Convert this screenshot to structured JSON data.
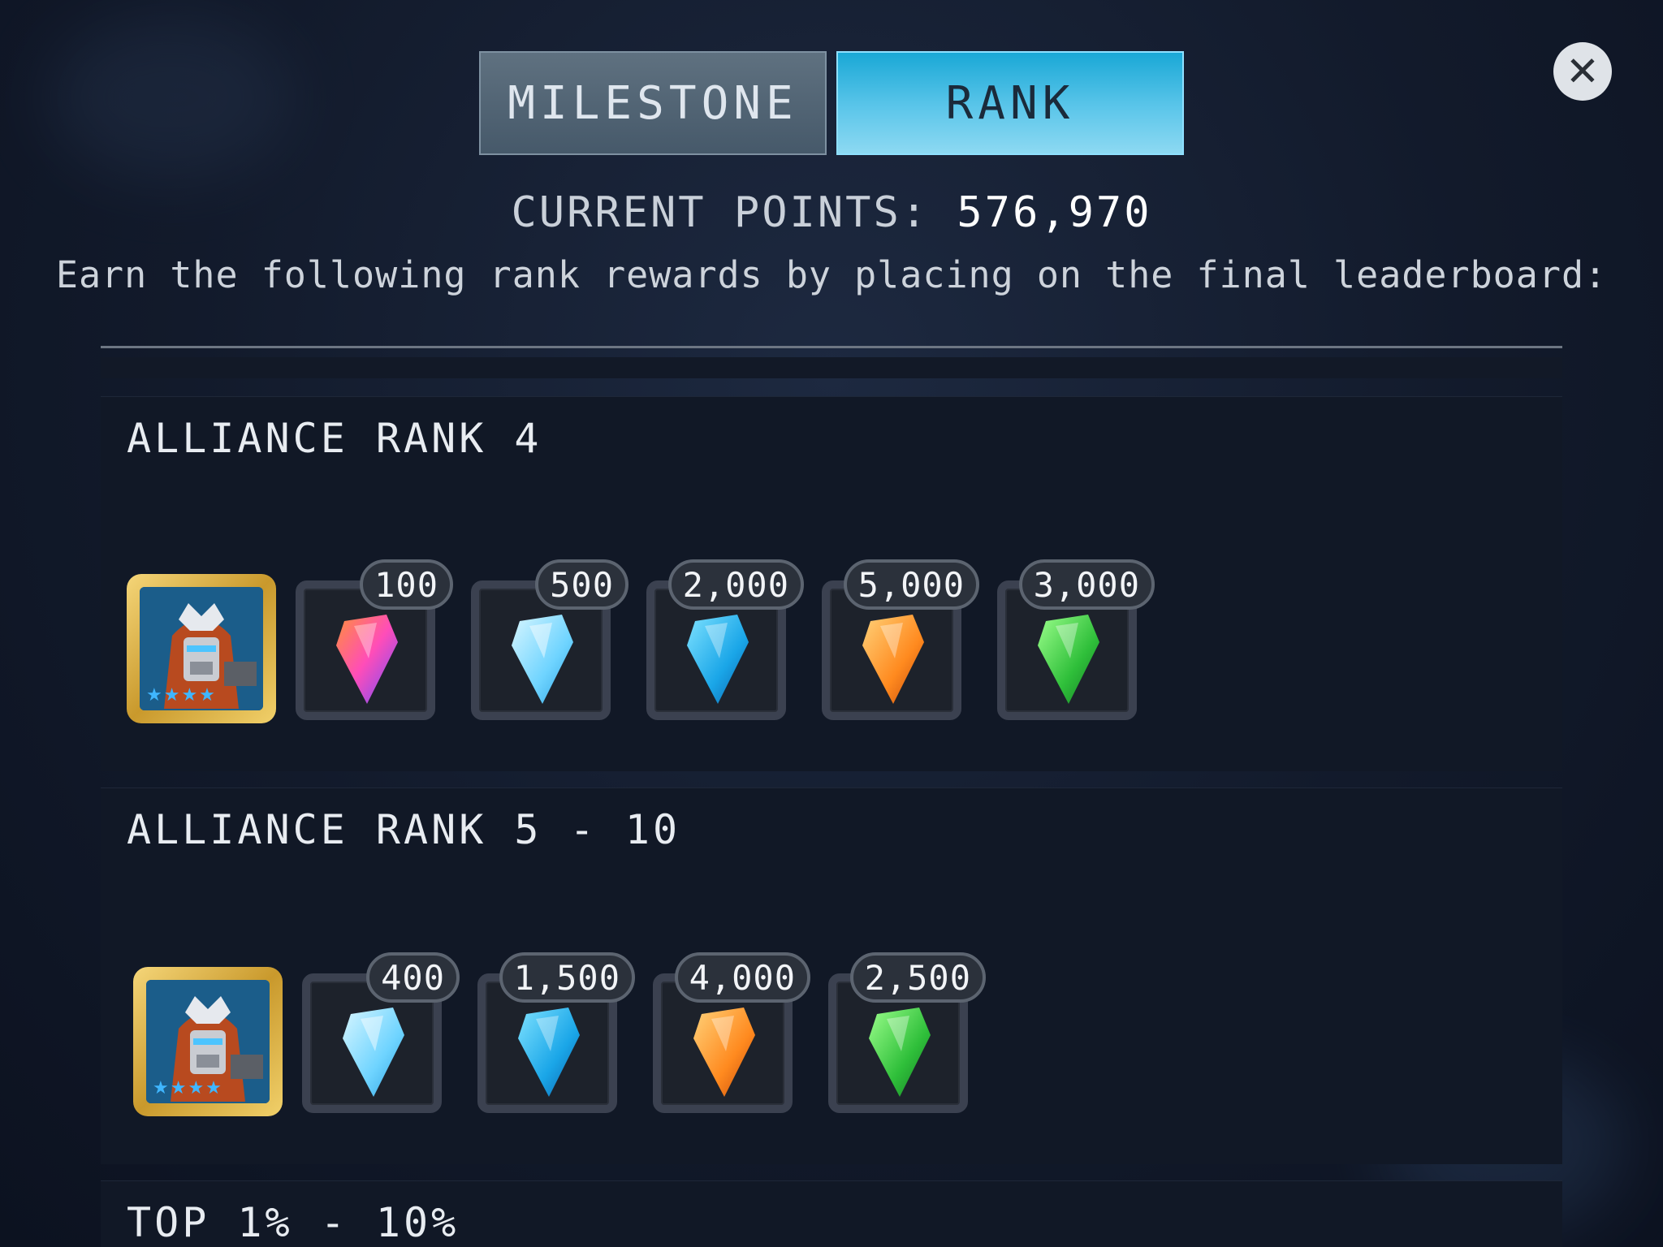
{
  "tabs": [
    {
      "label": "MILESTONE",
      "active": false
    },
    {
      "label": "RANK",
      "active": true
    }
  ],
  "close_icon": "close-icon",
  "points": {
    "label": "CURRENT POINTS:",
    "value": "576,970"
  },
  "subtitle": "Earn the following rank rewards by placing on the final leaderboard:",
  "panels": [
    {
      "title": "ALLIANCE RANK 4",
      "hero": {
        "icon": "hero-portrait-icon",
        "stars": "★★★★"
      },
      "rewards": [
        {
          "amount": "100",
          "crystal": "rainbow-crystal-icon"
        },
        {
          "amount": "500",
          "crystal": "light-blue-crystal-icon"
        },
        {
          "amount": "2,000",
          "crystal": "blue-crystal-icon"
        },
        {
          "amount": "5,000",
          "crystal": "orange-crystal-icon"
        },
        {
          "amount": "3,000",
          "crystal": "green-crystal-icon"
        }
      ]
    },
    {
      "title": "ALLIANCE RANK 5 - 10",
      "hero": {
        "icon": "hero-portrait-icon",
        "stars": "★★★★"
      },
      "rewards": [
        {
          "amount": "400",
          "crystal": "light-blue-crystal-icon"
        },
        {
          "amount": "1,500",
          "crystal": "blue-crystal-icon"
        },
        {
          "amount": "4,000",
          "crystal": "orange-crystal-icon"
        },
        {
          "amount": "2,500",
          "crystal": "green-crystal-icon"
        }
      ]
    },
    {
      "title": "TOP 1% - 10%"
    }
  ],
  "colors": {
    "tab_active": "#5cc6ea",
    "tab_inactive": "#4f6272",
    "panel": "#111826",
    "hero_frame": "#d9ab3d"
  }
}
